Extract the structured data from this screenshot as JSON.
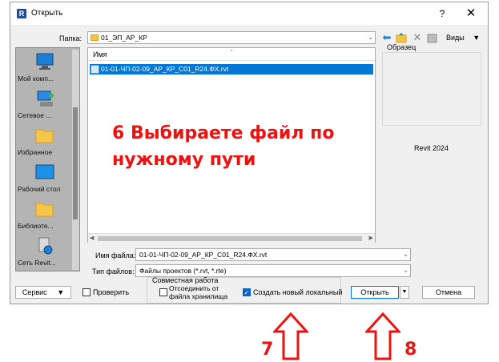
{
  "window": {
    "title": "Открыть",
    "help_glyph": "?",
    "close_glyph": "✕"
  },
  "location": {
    "label": "Папка:",
    "value": "01_ЭП_АР_КР"
  },
  "toolbar": {
    "views_label": "Виды",
    "icons": [
      "back-arrow-icon",
      "folder-up-icon",
      "delete-icon",
      "new-folder-icon",
      "views-icon"
    ]
  },
  "places": [
    {
      "label": "Мой комп...",
      "icon": "computer-icon"
    },
    {
      "label": "Сетевое ...",
      "icon": "network-icon"
    },
    {
      "label": "Избранное",
      "icon": "favorites-folder-icon"
    },
    {
      "label": "Рабочий стол",
      "icon": "desktop-icon"
    },
    {
      "label": "Библиоте...",
      "icon": "library-folder-icon"
    },
    {
      "label": "Сеть Revit...",
      "icon": "revit-network-icon"
    }
  ],
  "file_list": {
    "column_header": "Имя",
    "files": [
      {
        "name": "01-01-ЧП-02-09_АР_КР_С01_R24.ФХ.rvt",
        "selected": true
      }
    ]
  },
  "preview": {
    "label": "Образец",
    "version": "Revit 2024"
  },
  "filename": {
    "label": "Имя файла:",
    "value": "01-01-ЧП-02-09_АР_КР_С01_R24.ФХ.rvt"
  },
  "filetype": {
    "label": "Тип файлов:",
    "value": "Файлы проектов  (*.rvt, *.rte)"
  },
  "bottom": {
    "tools_label": "Сервис",
    "audit_label": "Проверить",
    "worksharing_title": "Совместная работа",
    "detach_label": "Отсоединить от файла хранилища",
    "create_local_label": "Создать новый локальный",
    "open_label": "Открыть",
    "cancel_label": "Отмена"
  },
  "annotation": {
    "line1": "6 Выбираете файл по",
    "line2": "нужному пути",
    "step7": "7",
    "step8": "8",
    "color": "#ee1111"
  },
  "colors": {
    "selection": "#0078d7",
    "dialog_bg": "#f0f0f0",
    "places_bg": "#b4b4b4"
  }
}
